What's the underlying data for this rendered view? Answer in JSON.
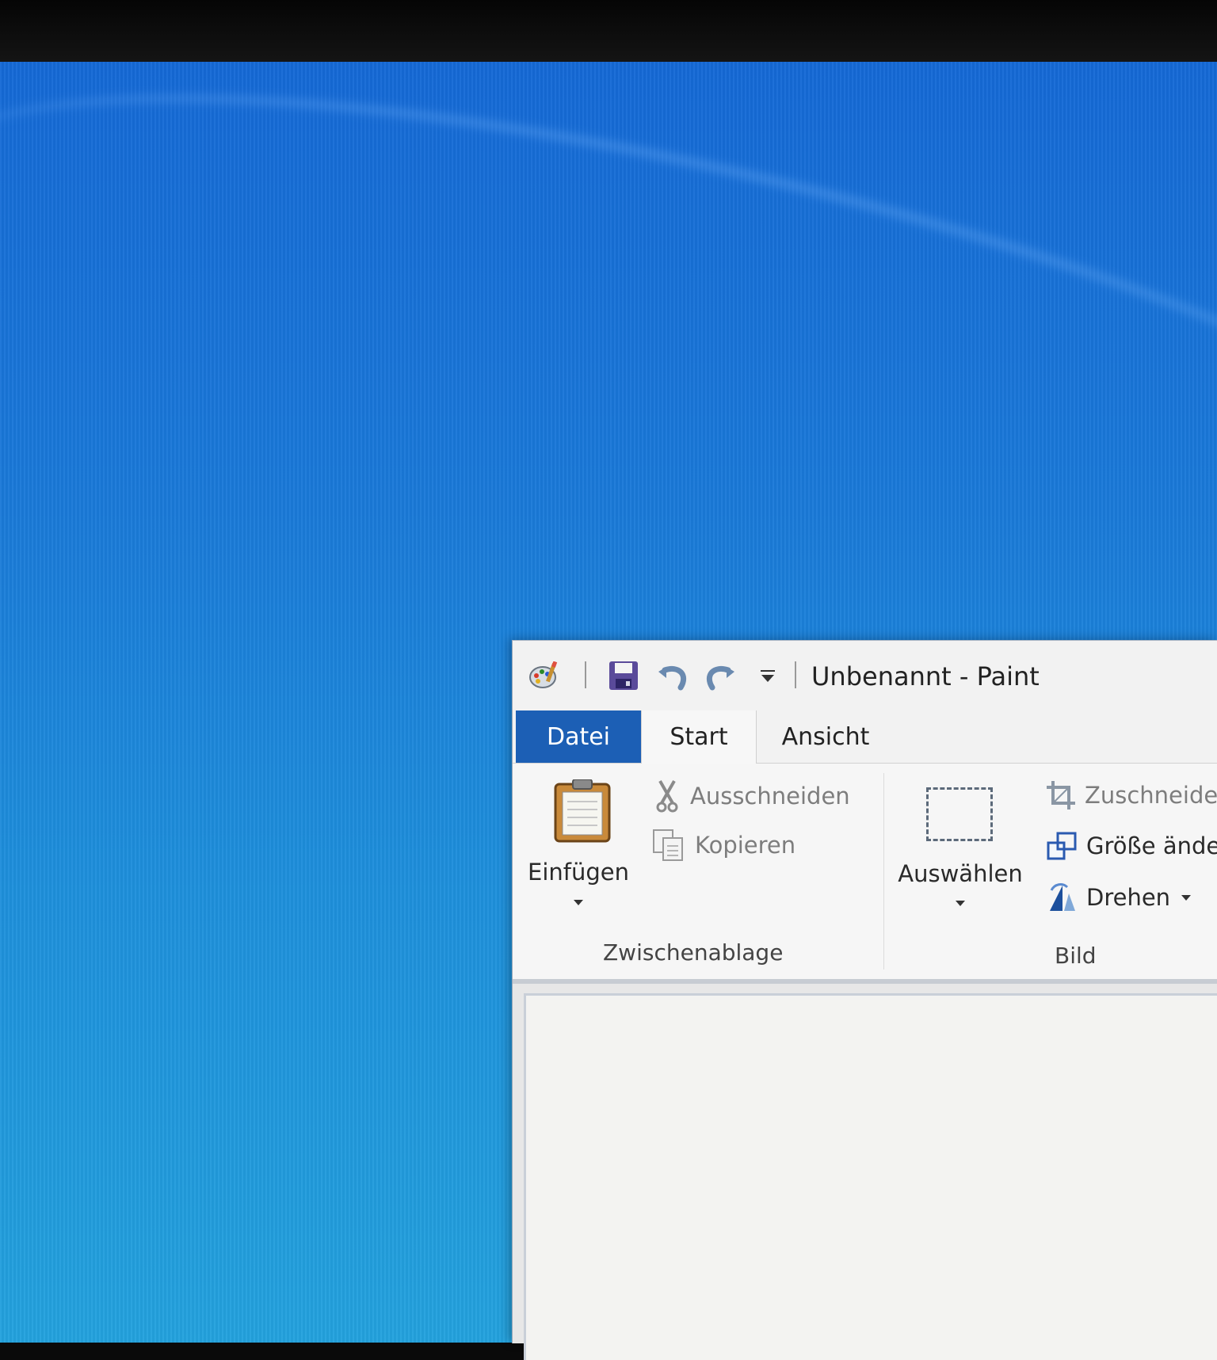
{
  "window": {
    "title": "Unbenannt - Paint",
    "qat_icons": [
      "paint-app-icon",
      "save-icon",
      "undo-icon",
      "redo-icon",
      "customize-qat-icon"
    ]
  },
  "tabs": [
    {
      "label": "Datei",
      "active": false,
      "highlight": "#1c5fb5"
    },
    {
      "label": "Start",
      "active": true
    },
    {
      "label": "Ansicht",
      "active": false
    }
  ],
  "ribbon": {
    "clipboard": {
      "paste_label": "Einfügen",
      "cut_label": "Ausschneiden",
      "copy_label": "Kopieren",
      "group_label": "Zwischenablage"
    },
    "image": {
      "select_label": "Auswählen",
      "crop_label": "Zuschneide",
      "resize_label": "Größe ände",
      "rotate_label": "Drehen",
      "group_label": "Bild"
    }
  },
  "colors": {
    "desktop": "#1a7ad9",
    "file_tab": "#1c5fb5"
  }
}
